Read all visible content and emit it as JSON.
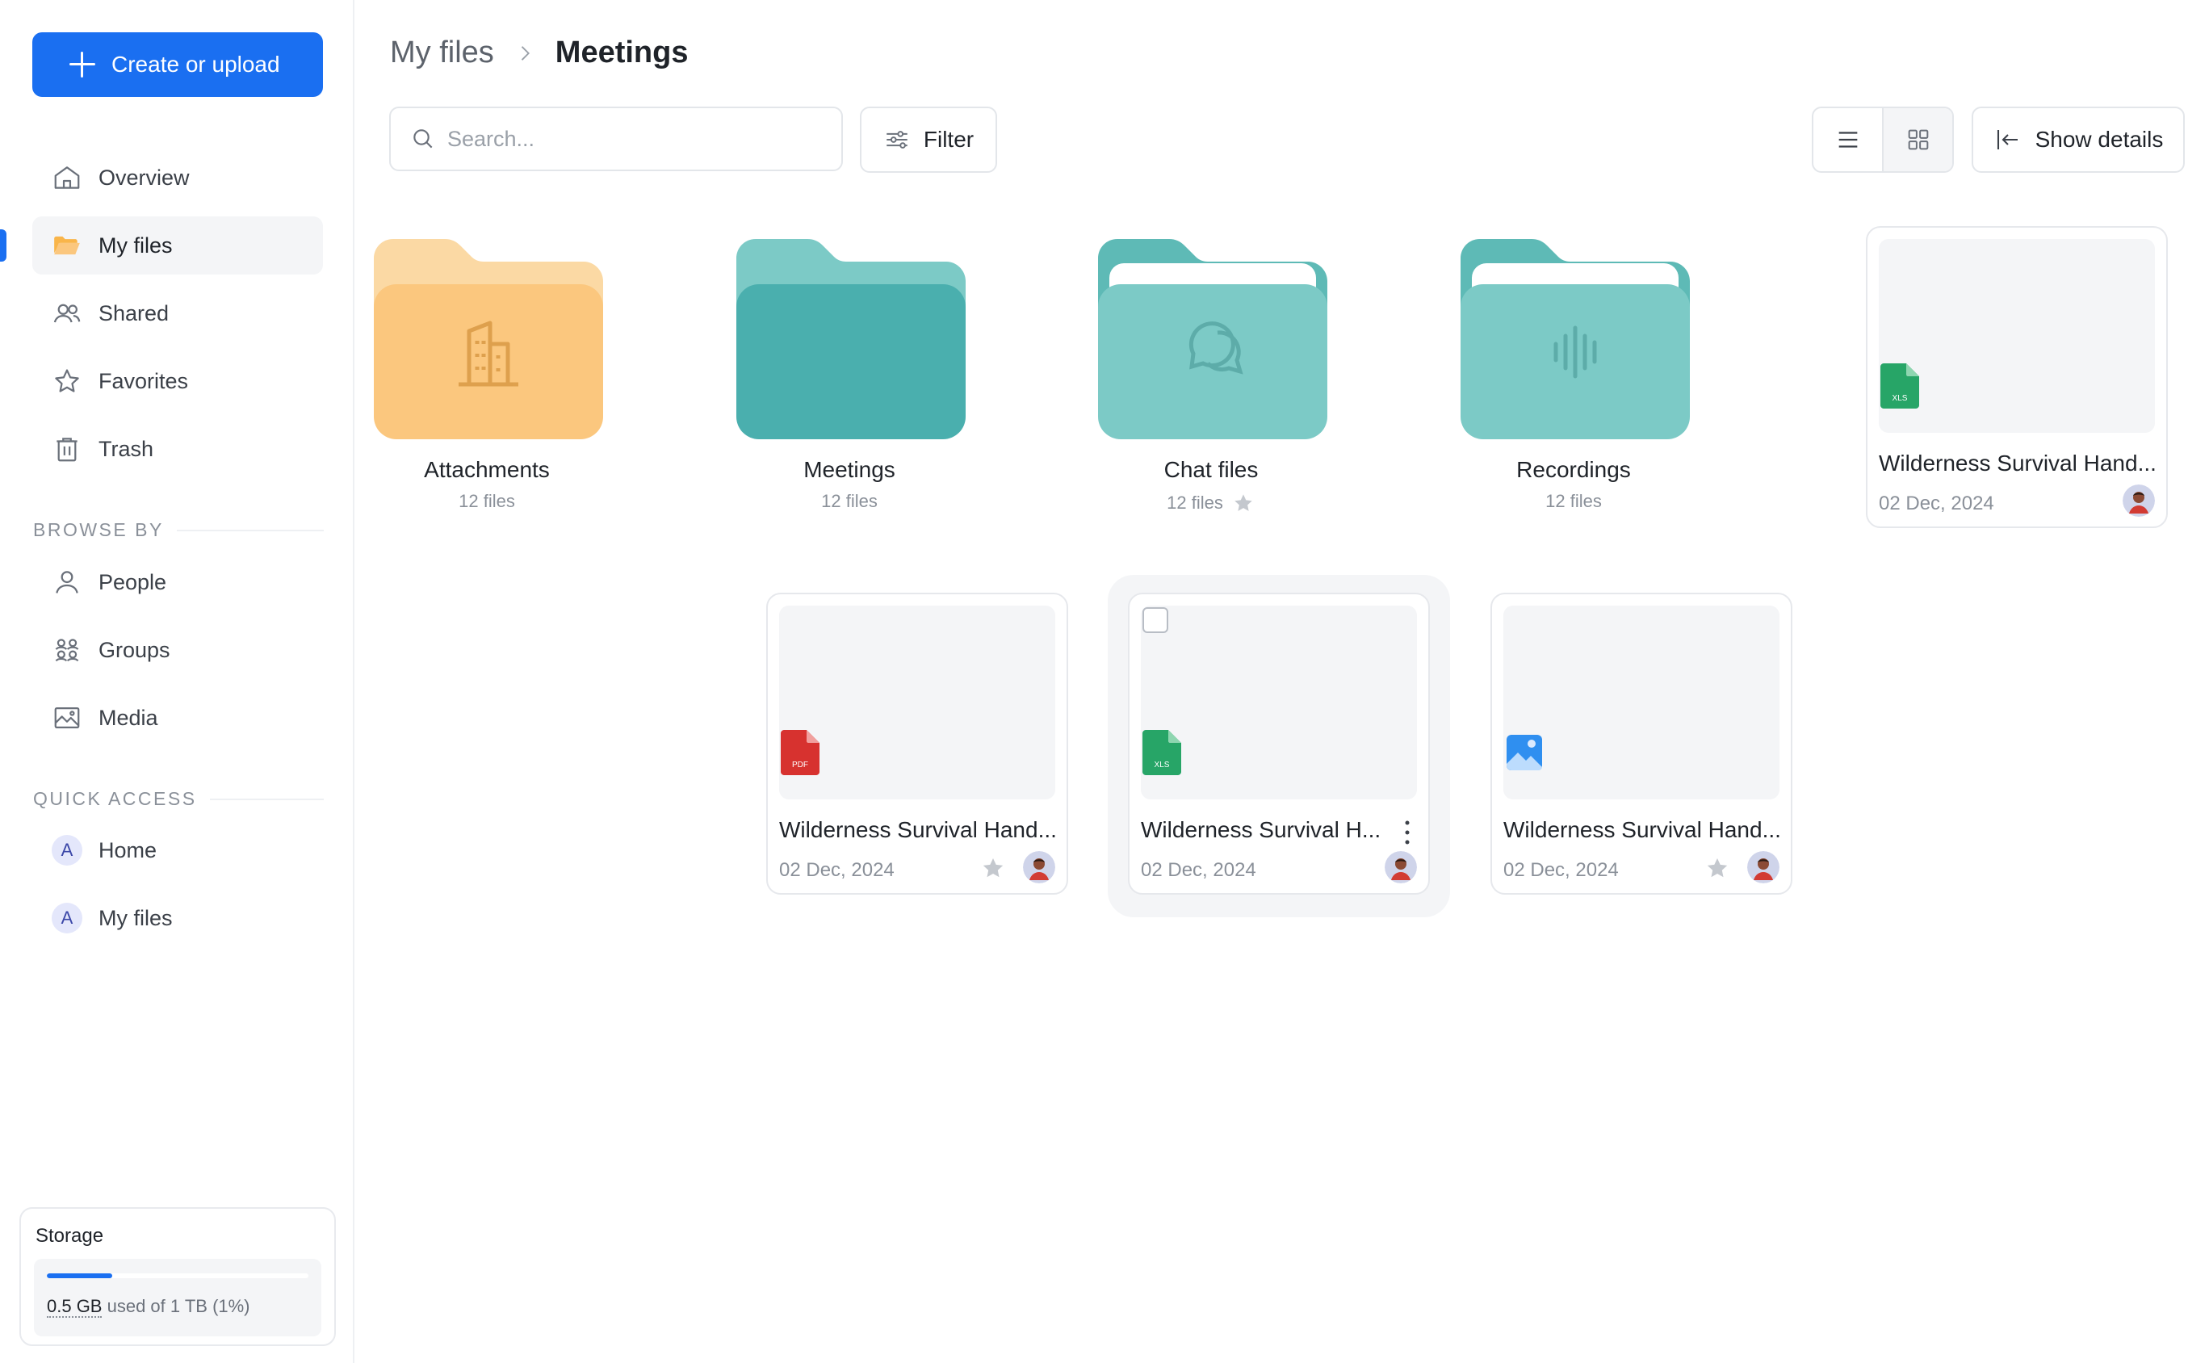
{
  "sidebar": {
    "create_label": "Create or upload",
    "nav": [
      {
        "label": "Overview",
        "icon": "home-icon"
      },
      {
        "label": "My files",
        "icon": "folder-open-icon",
        "active": true
      },
      {
        "label": "Shared",
        "icon": "users-icon"
      },
      {
        "label": "Favorites",
        "icon": "star-icon"
      },
      {
        "label": "Trash",
        "icon": "trash-icon"
      }
    ],
    "browse_by_label": "BROWSE BY",
    "browse": [
      {
        "label": "People",
        "icon": "user-icon"
      },
      {
        "label": "Groups",
        "icon": "group-icon"
      },
      {
        "label": "Media",
        "icon": "image-icon"
      }
    ],
    "quick_access_label": "QUICK ACCESS",
    "quick": [
      {
        "label": "Home",
        "initial": "A"
      },
      {
        "label": "My files",
        "initial": "A"
      }
    ],
    "storage": {
      "title": "Storage",
      "used": "0.5 GB",
      "rest": "used of 1 TB (1%)",
      "percent": 0.25
    }
  },
  "header": {
    "breadcrumb_parent": "My files",
    "breadcrumb_current": "Meetings",
    "search_placeholder": "Search...",
    "filter_label": "Filter",
    "details_label": "Show details"
  },
  "folders": [
    {
      "name": "Attachments",
      "meta": "12 files",
      "color": "#fbc77e",
      "icon": "building-icon"
    },
    {
      "name": "Meetings",
      "meta": "12 files",
      "color": "#4aafae",
      "icon": "none"
    },
    {
      "name": "Chat files",
      "meta": "12 files",
      "color": "#7ccac6",
      "icon": "chat-icon",
      "starred": true
    },
    {
      "name": "Recordings",
      "meta": "12 files",
      "color": "#7ccac6",
      "icon": "audio-wave-icon"
    }
  ],
  "files": [
    {
      "name": "Wilderness Survival Hand...",
      "date": "02 Dec, 2024",
      "type": "XLS",
      "starred": false
    },
    {
      "name": "Wilderness Survival Hand...",
      "date": "02 Dec, 2024",
      "type": "PDF",
      "starred": true
    },
    {
      "name": "Wilderness Survival H...",
      "date": "02 Dec, 2024",
      "type": "XLS",
      "starred": false,
      "hovered": true
    },
    {
      "name": "Wilderness Survival Hand...",
      "date": "02 Dec, 2024",
      "type": "IMG",
      "starred": true
    }
  ],
  "colors": {
    "accent": "#1a6ff1",
    "xls": "#27a567",
    "pdf": "#d7322f",
    "img": "#2f8ff0",
    "star_muted": "#c4c8ce"
  }
}
